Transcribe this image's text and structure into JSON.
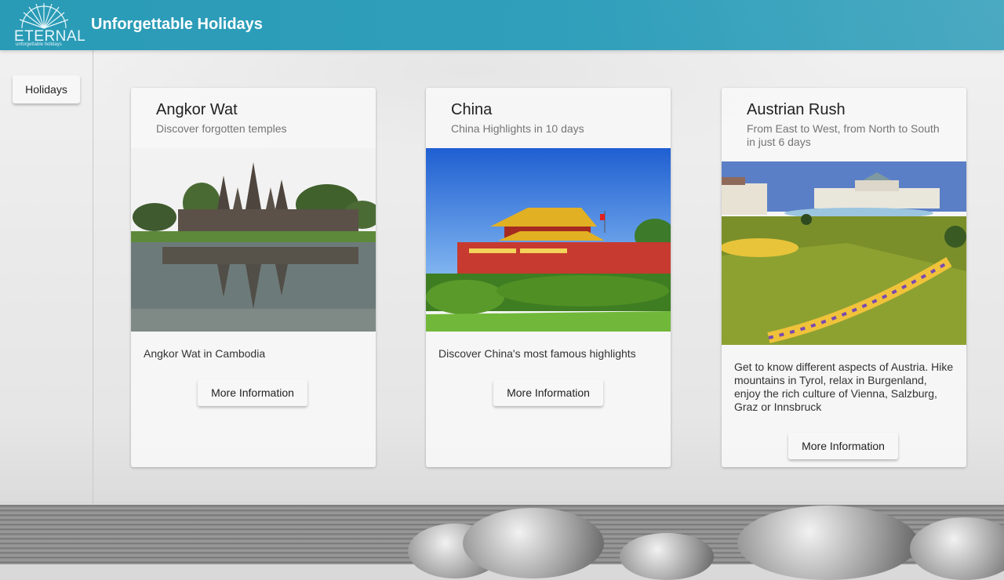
{
  "header": {
    "logo_text": "ETERNAL",
    "logo_tagline": "unforgettable holidays",
    "title": "Unforgettable Holidays"
  },
  "sidebar": {
    "holidays_label": "Holidays"
  },
  "cards": [
    {
      "title": "Angkor Wat",
      "subtitle": "Discover forgotten temples",
      "description": "Angkor Wat in Cambodia",
      "button_label": "More Information",
      "image": "angkor-wat-temple-photo"
    },
    {
      "title": "China",
      "subtitle": "China Highlights in 10 days",
      "description": "Discover China's most famous highlights",
      "button_label": "More Information",
      "image": "tiananmen-gate-photo"
    },
    {
      "title": "Austrian Rush",
      "subtitle": "From East to West, from North to South in just 6 days",
      "description": "Get to know different aspects of Austria. Hike mountains in Tyrol, relax in Burgenland, enjoy the rich culture of Vienna, Salzburg, Graz or Innsbruck",
      "button_label": "More Information",
      "image": "belvedere-palace-garden-photo"
    }
  ],
  "colors": {
    "header": "#2f9fbb",
    "card": "#f7f7f7"
  }
}
